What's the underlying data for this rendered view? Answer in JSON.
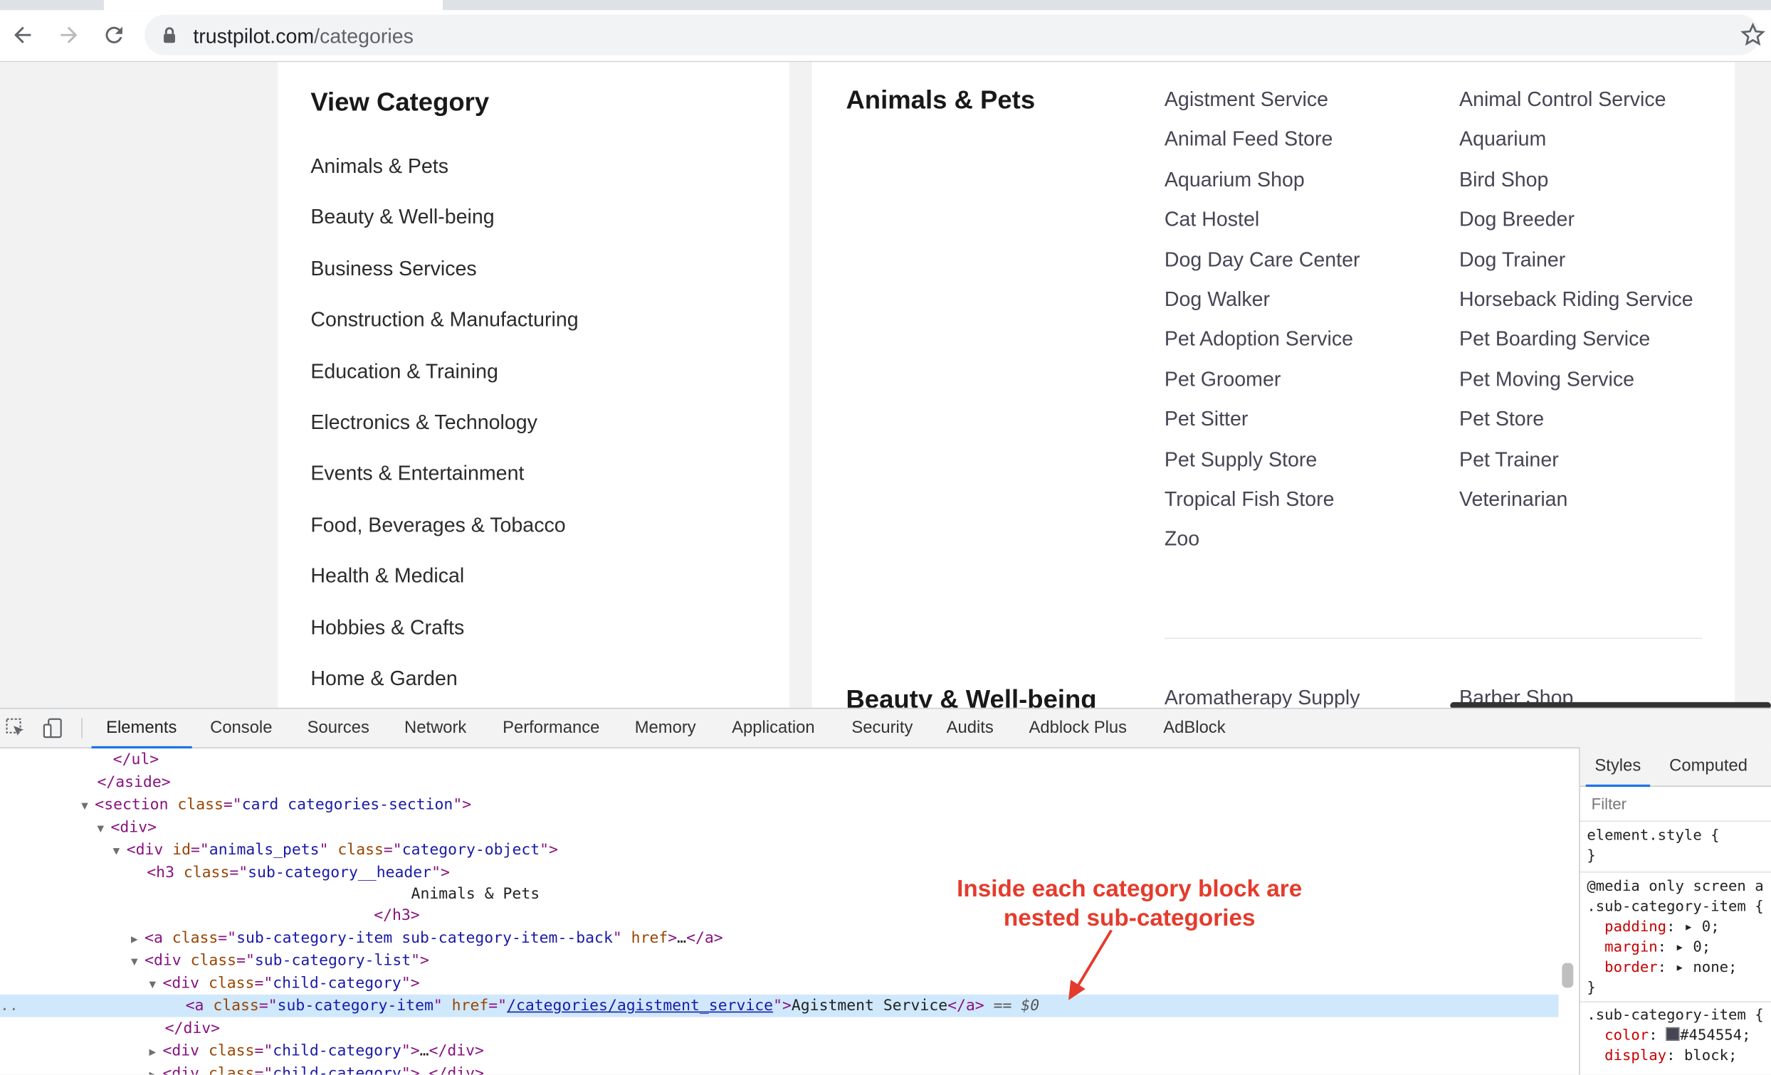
{
  "browser": {
    "url_host": "trustpilot.com",
    "url_path": "/categories"
  },
  "sidebar": {
    "title": "View Category",
    "items": [
      "Animals & Pets",
      "Beauty & Well-being",
      "Business Services",
      "Construction & Manufacturing",
      "Education & Training",
      "Electronics & Technology",
      "Events & Entertainment",
      "Food, Beverages & Tobacco",
      "Health & Medical",
      "Hobbies & Crafts",
      "Home & Garden"
    ]
  },
  "section_animals": {
    "header": "Animals & Pets",
    "col1": [
      "Agistment Service",
      "Animal Feed Store",
      "Aquarium Shop",
      "Cat Hostel",
      "Dog Day Care Center",
      "Dog Walker",
      "Pet Adoption Service",
      "Pet Groomer",
      "Pet Sitter",
      "Pet Supply Store",
      "Tropical Fish Store",
      "Zoo"
    ],
    "col2": [
      "Animal Control Service",
      "Aquarium",
      "Bird Shop",
      "Dog Breeder",
      "Dog Trainer",
      "Horseback Riding Service",
      "Pet Boarding Service",
      "Pet Moving Service",
      "Pet Store",
      "Pet Trainer",
      "Veterinarian"
    ]
  },
  "section_beauty": {
    "header": "Beauty & Well-being",
    "first_col1": "Aromatherapy Supply",
    "first_col2": "Barber Shop"
  },
  "devtools": {
    "tabs": [
      "Elements",
      "Console",
      "Sources",
      "Network",
      "Performance",
      "Memory",
      "Application",
      "Security",
      "Audits",
      "Adblock Plus",
      "AdBlock"
    ],
    "dom": {
      "l1": "</ul>",
      "l2": "</aside>",
      "section_tag": "section",
      "section_class": "card categories-section",
      "div": "div",
      "cat_id": "animals_pets",
      "cat_class": "category-object",
      "h3_class": "sub-category__header",
      "h3_text": "Animals & Pets",
      "h3_close": "</h3>",
      "back_class": "sub-category-item sub-category-item--back",
      "list_class": "sub-category-list",
      "child_class": "child-category",
      "link_class": "sub-category-item",
      "link_href": "/categories/agistment_service",
      "link_text": "Agistment Service",
      "selected_marker": "== $0",
      "div_close": "</div>",
      "ellipsis": "…"
    },
    "annotation": "Inside each category block are nested sub-categories",
    "styles": {
      "tabs": [
        "Styles",
        "Computed"
      ],
      "filter_placeholder": "Filter",
      "element_style": "element.style {",
      "close_brace": "}",
      "media": "@media only screen a",
      "selector": ".sub-category-item {",
      "padding": "padding",
      "padding_val": "0;",
      "margin": "margin",
      "margin_val": "0;",
      "border": "border",
      "border_val": "none;",
      "color": "color",
      "color_val": "#454554;",
      "display": "display",
      "display_val": "block;"
    }
  }
}
